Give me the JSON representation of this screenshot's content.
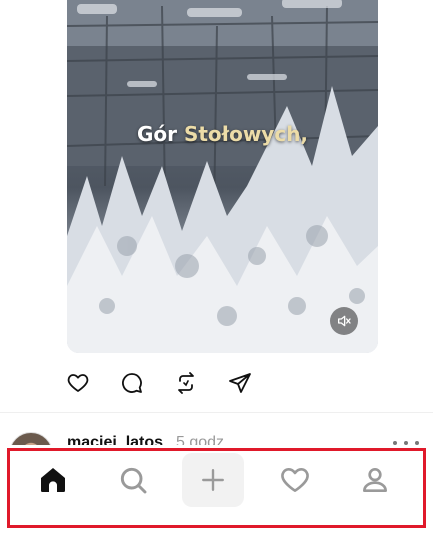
{
  "post": {
    "caption_part1": "Gór ",
    "caption_part2": "Stołowych,",
    "caption_accent_color": "#ecdca8",
    "mute_icon": "speaker-muted-icon"
  },
  "actions": {
    "like_icon": "heart-icon",
    "comment_icon": "comment-bubble-icon",
    "repost_icon": "repost-icon",
    "share_icon": "send-icon"
  },
  "next_post": {
    "username": "maciej_latos",
    "timestamp": "5 godz.",
    "more_icon": "more-dots-icon"
  },
  "bottom_nav": {
    "items": [
      {
        "name": "home",
        "icon": "home-icon",
        "active": true
      },
      {
        "name": "search",
        "icon": "search-icon",
        "active": false
      },
      {
        "name": "new-post",
        "icon": "plus-icon",
        "active": false
      },
      {
        "name": "activity",
        "icon": "heart-icon",
        "active": false
      },
      {
        "name": "profile",
        "icon": "person-icon",
        "active": false
      }
    ],
    "highlight_color": "#e0192a"
  }
}
